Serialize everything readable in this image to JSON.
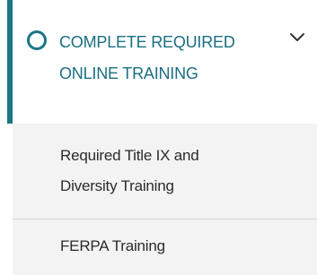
{
  "section": {
    "title_line1": "COMPLETE REQUIRED",
    "title_line2": "ONLINE TRAINING",
    "status_icon": "circle-outline-icon",
    "toggle_icon": "chevron-down-icon",
    "accent_color": "#1a7587"
  },
  "items": [
    {
      "line1": "Required Title IX and",
      "line2": "Diversity Training"
    },
    {
      "line1": "FERPA Training"
    }
  ]
}
